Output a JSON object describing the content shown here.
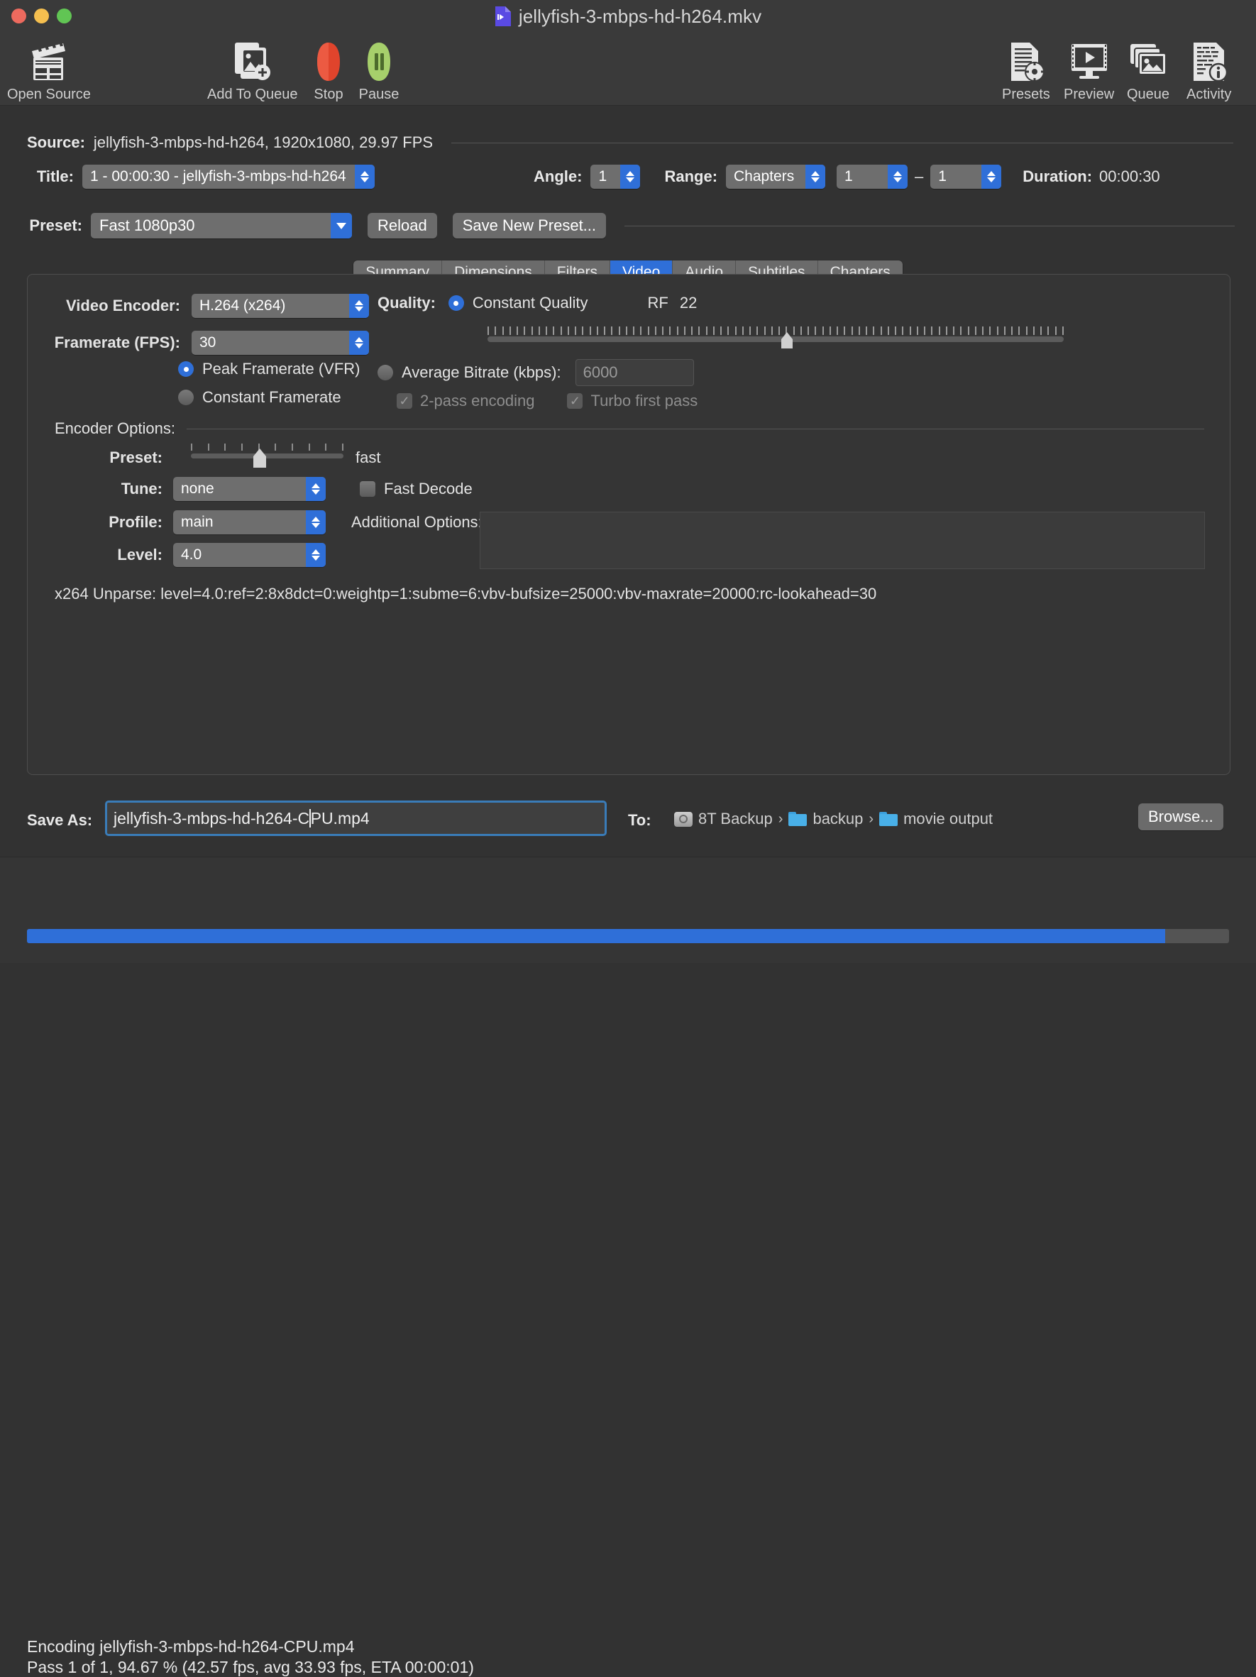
{
  "window": {
    "title": "jellyfish-3-mbps-hd-h264.mkv",
    "traffic": {
      "close": "close-button",
      "minimize": "minimize-button",
      "zoom": "zoom-button"
    }
  },
  "toolbar": {
    "items": [
      {
        "label": "Open Source",
        "icon": "film-clapper-icon"
      },
      {
        "label": "Add To Queue",
        "icon": "add-media-icon"
      },
      {
        "label": "Stop",
        "icon": "stop-octagon-icon"
      },
      {
        "label": "Pause",
        "icon": "pause-circle-icon"
      },
      {
        "label": "Presets",
        "icon": "presets-gear-icon"
      },
      {
        "label": "Preview",
        "icon": "preview-monitor-icon"
      },
      {
        "label": "Queue",
        "icon": "queue-stack-icon"
      },
      {
        "label": "Activity",
        "icon": "activity-info-icon"
      }
    ]
  },
  "source": {
    "label": "Source:",
    "value": "jellyfish-3-mbps-hd-h264, 1920x1080, 29.97 FPS",
    "title_label": "Title:",
    "title_value": "1 - 00:00:30 - jellyfish-3-mbps-hd-h264",
    "angle_label": "Angle:",
    "angle_value": "1",
    "range_label": "Range:",
    "range_value": "Chapters",
    "range_start": "1",
    "range_dash": "–",
    "range_end": "1",
    "duration_label": "Duration:",
    "duration_value": "00:00:30"
  },
  "preset": {
    "label": "Preset:",
    "value": "Fast 1080p30",
    "reload_label": "Reload",
    "save_label": "Save New Preset..."
  },
  "tabs": [
    {
      "label": "Summary",
      "active": false
    },
    {
      "label": "Dimensions",
      "active": false
    },
    {
      "label": "Filters",
      "active": false
    },
    {
      "label": "Video",
      "active": true
    },
    {
      "label": "Audio",
      "active": false
    },
    {
      "label": "Subtitles",
      "active": false
    },
    {
      "label": "Chapters",
      "active": false
    }
  ],
  "video": {
    "encoder_label": "Video Encoder:",
    "encoder_value": "H.264 (x264)",
    "framerate_label": "Framerate (FPS):",
    "framerate_value": "30",
    "peak_framerate_label": "Peak Framerate (VFR)",
    "constant_framerate_label": "Constant Framerate",
    "quality_label": "Quality:",
    "constant_quality_label": "Constant Quality",
    "rf_label": "RF",
    "rf_value": "22",
    "rf_percent": 52,
    "avg_bitrate_label": "Average Bitrate (kbps):",
    "avg_bitrate_value": "6000",
    "two_pass_label": "2-pass encoding",
    "turbo_label": "Turbo first pass"
  },
  "encoder_options": {
    "section_label": "Encoder Options:",
    "preset_label": "Preset:",
    "preset_slider_value": "fast",
    "preset_slider_percent": 45,
    "tune_label": "Tune:",
    "tune_value": "none",
    "fast_decode_label": "Fast Decode",
    "profile_label": "Profile:",
    "profile_value": "main",
    "additional_label": "Additional Options:",
    "additional_value": "",
    "level_label": "Level:",
    "level_value": "4.0",
    "unparse": "x264 Unparse: level=4.0:ref=2:8x8dct=0:weightp=1:subme=6:vbv-bufsize=25000:vbv-maxrate=20000:rc-lookahead=30"
  },
  "save": {
    "label": "Save As:",
    "value_before_caret": "jellyfish-3-mbps-hd-h264-C",
    "value_after_caret": "PU.mp4",
    "to_label": "To:",
    "path": [
      {
        "name": "8T Backup",
        "icon": "hard-drive-icon"
      },
      {
        "name": "backup",
        "icon": "folder-icon"
      },
      {
        "name": "movie output",
        "icon": "folder-icon"
      }
    ],
    "browse_label": "Browse..."
  },
  "status": {
    "line1": "Encoding jellyfish-3-mbps-hd-h264-CPU.mp4",
    "line2": "Pass 1 of 1, 94.67 % (42.57 fps, avg 33.93 fps, ETA 00:00:01)",
    "progress_percent": 94.67
  },
  "colors": {
    "accent": "#2f6fd8",
    "window_bg": "#323232",
    "chrome_bg": "#3a3a3a",
    "panel_bg": "#353535"
  }
}
